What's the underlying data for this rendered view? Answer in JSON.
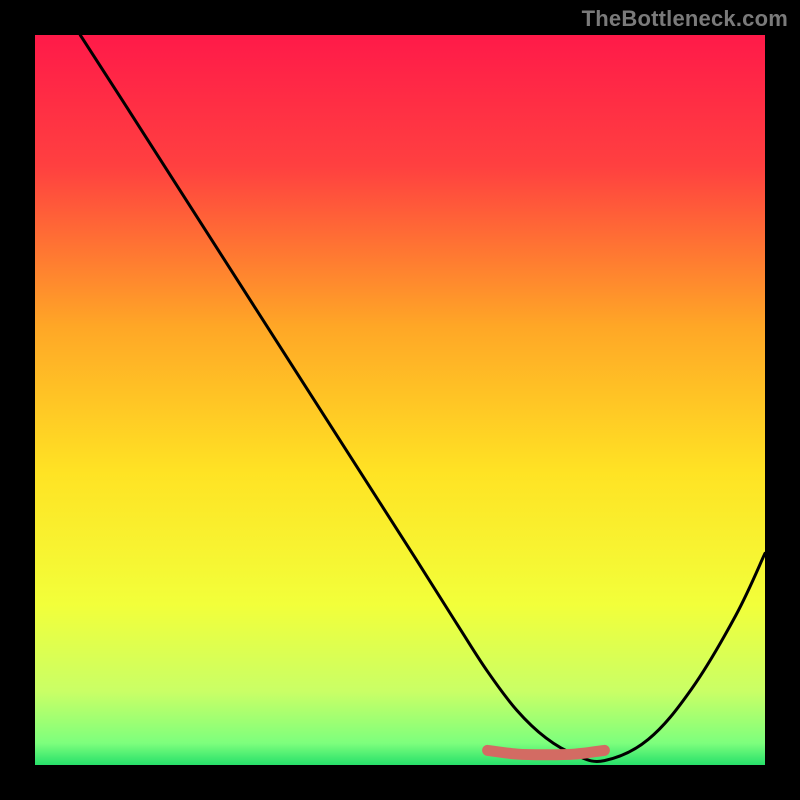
{
  "watermark": "TheBottleneck.com",
  "chart_data": {
    "type": "line",
    "title": "",
    "xlabel": "",
    "ylabel": "",
    "xlim": [
      0,
      100
    ],
    "ylim": [
      0,
      100
    ],
    "grid": false,
    "legend": false,
    "gradient_stops": [
      {
        "offset": 0,
        "color": "#ff1a49"
      },
      {
        "offset": 18,
        "color": "#ff4040"
      },
      {
        "offset": 40,
        "color": "#ffa726"
      },
      {
        "offset": 60,
        "color": "#ffe324"
      },
      {
        "offset": 78,
        "color": "#f2ff3a"
      },
      {
        "offset": 90,
        "color": "#c9ff66"
      },
      {
        "offset": 97,
        "color": "#7dff7d"
      },
      {
        "offset": 100,
        "color": "#27e06a"
      }
    ],
    "series": [
      {
        "name": "bottleneck-curve",
        "color": "#000000",
        "x": [
          6.2,
          12,
          20,
          28,
          36,
          44,
          52,
          58,
          62,
          66,
          70,
          74,
          78,
          84,
          90,
          96,
          100
        ],
        "y": [
          100,
          91,
          78.5,
          66,
          53.5,
          41,
          28.5,
          19,
          12.8,
          7.5,
          3.7,
          1.4,
          0.6,
          3.5,
          10.5,
          20.5,
          29
        ]
      },
      {
        "name": "optimal-band",
        "color": "#d36b63",
        "x": [
          62,
          66,
          70,
          74,
          78
        ],
        "y": [
          2.0,
          1.5,
          1.4,
          1.5,
          2.0
        ]
      }
    ]
  }
}
